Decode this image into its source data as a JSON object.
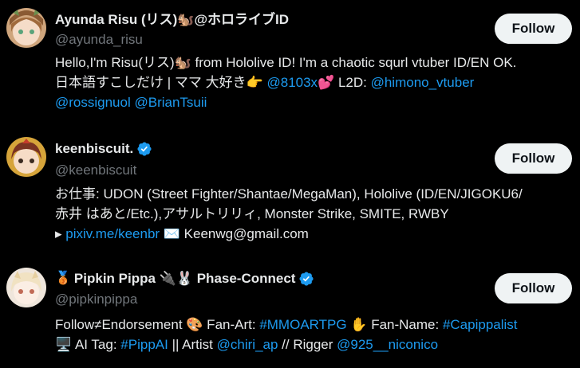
{
  "users": [
    {
      "name": "Ayunda Risu (リス)🐿️@ホロライブID",
      "handle": "@ayunda_risu",
      "follow_label": "Follow",
      "verified": false,
      "bio_lines": [
        [
          {
            "t": "Hello,I'm Risu(リス)🐿️ from Hololive ID! I'm a chaotic squrl vtuber ID/EN OK."
          }
        ],
        [
          {
            "t": "日本語すこしだけ | ママ 大好き👉 "
          },
          {
            "t": "@8103x",
            "link": true
          },
          {
            "t": "💕 L2D: "
          },
          {
            "t": "@himono_vtuber",
            "link": true
          }
        ],
        [
          {
            "t": "@rossignuol",
            "link": true
          },
          {
            "t": " "
          },
          {
            "t": "@BrianTsuii",
            "link": true
          }
        ]
      ]
    },
    {
      "name": "keenbiscuit.",
      "handle": "@keenbiscuit",
      "follow_label": "Follow",
      "verified": true,
      "bio_lines": [
        [
          {
            "t": "お仕事: UDON (Street Fighter/Shantae/MegaMan), Hololive (ID/EN/JIGOKU6/"
          }
        ],
        [
          {
            "t": "赤井 はあと/Etc.),アサルトリリィ, Monster Strike, SMITE, RWBY"
          }
        ],
        [
          {
            "t": "▸ "
          },
          {
            "t": "pixiv.me/keenbr",
            "link": true
          },
          {
            "t": " ✉️ Keenwg@gmail.com"
          }
        ]
      ]
    },
    {
      "name_prefix": "🥉",
      "name": "Pipkin Pippa 🔌🐰 Phase-Connect",
      "handle": "@pipkinpippa",
      "follow_label": "Follow",
      "verified": true,
      "bio_lines": [
        [
          {
            "t": "Follow≠Endorsement 🎨 Fan-Art: "
          },
          {
            "t": "#MMOARTPG",
            "link": true
          },
          {
            "t": " ✋ Fan-Name: "
          },
          {
            "t": "#Capippalist",
            "link": true
          }
        ],
        [
          {
            "t": "🖥️ AI Tag: "
          },
          {
            "t": "#PippAI",
            "link": true
          },
          {
            "t": " || Artist "
          },
          {
            "t": "@chiri_ap",
            "link": true
          },
          {
            "t": " // Rigger "
          },
          {
            "t": "@925__niconico",
            "link": true
          }
        ]
      ]
    }
  ],
  "colors": {
    "background": "#000000",
    "text": "#e7e9ea",
    "muted": "#71767b",
    "link": "#1d9bf0",
    "verified": "#1d9bf0",
    "button_bg": "#eff3f4"
  }
}
